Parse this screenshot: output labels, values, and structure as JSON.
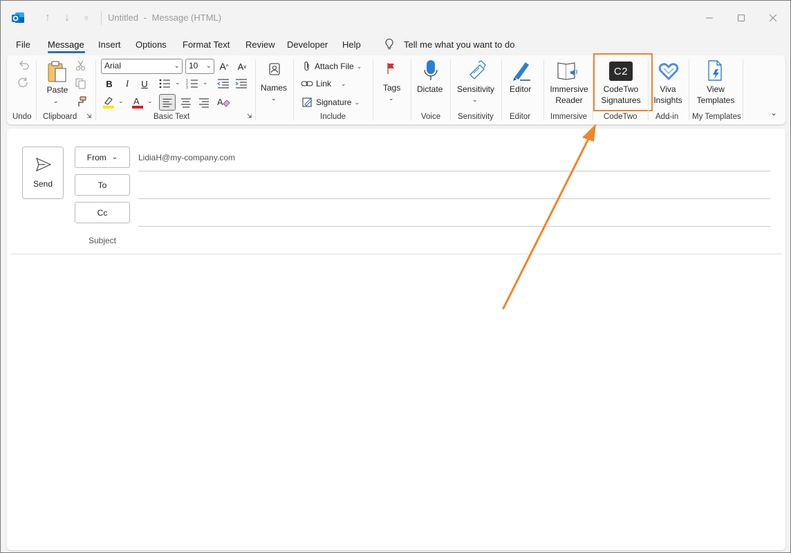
{
  "titlebar": {
    "title": "Untitled",
    "separator": "-",
    "subtitle": "Message (HTML)"
  },
  "menu": {
    "items": [
      "File",
      "Message",
      "Insert",
      "Options",
      "Format Text",
      "Review",
      "Developer",
      "Help"
    ],
    "active": "Message",
    "tell_me": "Tell me what you want to do"
  },
  "ribbon": {
    "groups": {
      "undo": "Undo",
      "clipboard": "Clipboard",
      "basic_text": "Basic Text",
      "include": "Include",
      "voice": "Voice",
      "sensitivity": "Sensitivity",
      "editor": "Editor",
      "immersive": "Immersive",
      "codetwo": "CodeTwo",
      "addin": "Add-in",
      "my_templates": "My Templates"
    },
    "paste": "Paste",
    "font_name": "Arial",
    "font_size": "10",
    "bold": "B",
    "italic": "I",
    "underline": "U",
    "names": "Names",
    "attach_file": "Attach File",
    "link": "Link",
    "signature": "Signature",
    "tags": "Tags",
    "dictate": "Dictate",
    "sensitivity": "Sensitivity",
    "editor": "Editor",
    "immersive_line1": "Immersive",
    "immersive_line2": "Reader",
    "codetwo_line1": "CodeTwo",
    "codetwo_line2": "Signatures",
    "codetwo_logo": "C2",
    "viva_line1": "Viva",
    "viva_line2": "Insights",
    "view_line1": "View",
    "view_line2": "Templates"
  },
  "compose": {
    "send": "Send",
    "from_label": "From",
    "from_value": "LidiaH@my-company.com",
    "to_label": "To",
    "cc_label": "Cc",
    "subject_label": "Subject"
  },
  "colors": {
    "accent": "#2a6ebb",
    "highlight_arrow": "#f0852a",
    "highlighter_yellow": "#ffe600",
    "font_red": "#d11f1f"
  }
}
